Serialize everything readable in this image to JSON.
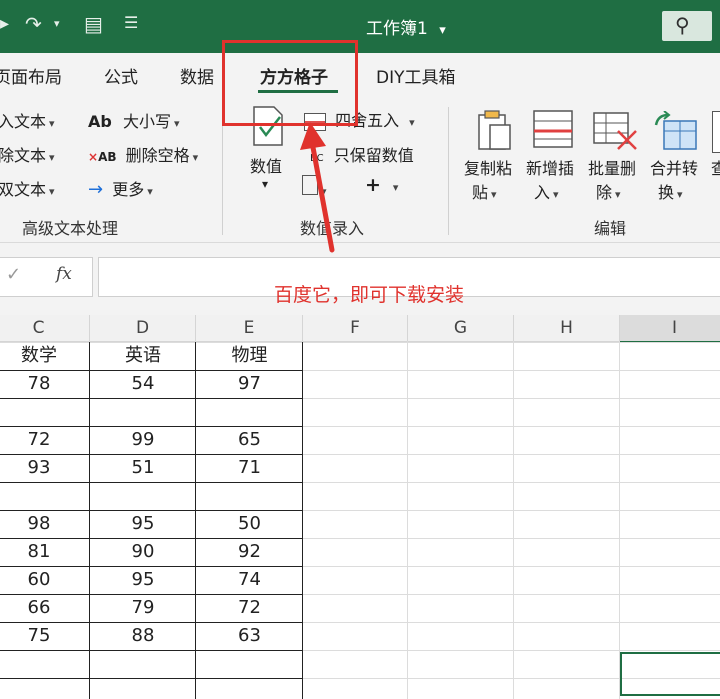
{
  "title_bar": {
    "document_title": "工作簿1",
    "title_caret": "▾"
  },
  "tabs": [
    {
      "label": "页面布局"
    },
    {
      "label": "公式"
    },
    {
      "label": "数据"
    },
    {
      "label": "方方格子",
      "active": true
    },
    {
      "label": "DIY工具箱"
    }
  ],
  "ribbon": {
    "left_items": [
      "入文本",
      "除文本",
      "双文本"
    ],
    "size_items": [
      "大小写",
      "删除空格",
      "更多"
    ],
    "ab_glyph": "Ab",
    "xab_glyph": "AB",
    "group1_label": "高级文本处理",
    "numeric_button": "数值",
    "round_item": "四舍五入",
    "keep_value_item": "只保留数值",
    "group2_label": "数值录入",
    "copy_paste": [
      "复制粘",
      "贴"
    ],
    "add_insert": [
      "新增插",
      "入"
    ],
    "batch_delete": [
      "批量删",
      "除"
    ],
    "merge_convert": [
      "合并转",
      "换"
    ],
    "cut_label": "查",
    "group3_label": "编辑"
  },
  "formula_bar": {
    "fx": "fx",
    "check": "✓"
  },
  "columns": [
    "C",
    "D",
    "E",
    "F",
    "G",
    "H",
    "I"
  ],
  "table": {
    "headers": [
      "数学",
      "英语",
      "物理"
    ],
    "rows": [
      [
        "78",
        "54",
        "97"
      ],
      [
        "",
        "",
        ""
      ],
      [
        "72",
        "99",
        "65"
      ],
      [
        "93",
        "51",
        "71"
      ],
      [
        "",
        "",
        ""
      ],
      [
        "98",
        "95",
        "50"
      ],
      [
        "81",
        "90",
        "92"
      ],
      [
        "60",
        "95",
        "74"
      ],
      [
        "66",
        "79",
        "72"
      ],
      [
        "75",
        "88",
        "63"
      ]
    ]
  },
  "annotation_text": "百度它，即可下载安装",
  "colors": {
    "title_green": "#1f6e43",
    "annotation_red": "#e0322d"
  }
}
